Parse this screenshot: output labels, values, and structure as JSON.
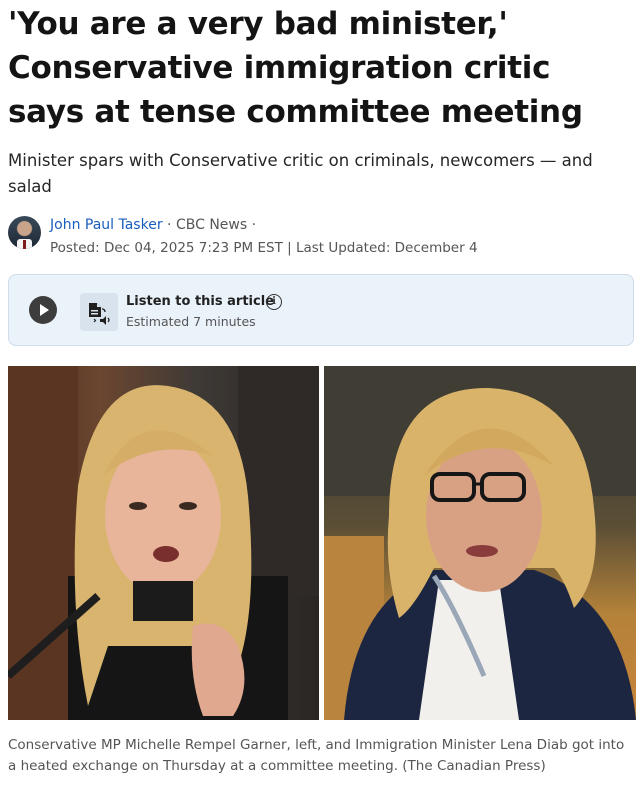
{
  "article": {
    "headline": "'You are a very bad minister,' Conservative immigration critic says at tense committee meeting",
    "dek": "Minister spars with Conservative critic on criminals, newcomers — and salad"
  },
  "byline": {
    "author": "John Paul Tasker",
    "separator1": " · ",
    "outlet": "CBC News",
    "separator2": " ·",
    "posted": "Posted: Dec 04, 2025 7:23 PM EST | Last Updated: December 4"
  },
  "audio": {
    "title": "Listen to this article",
    "duration": "Estimated 7 minutes",
    "info_glyph": "i",
    "icons": [
      "play-icon",
      "document-audio-icon",
      "info-icon"
    ]
  },
  "photo": {
    "caption": "Conservative MP Michelle Rempel Garner, left, and Immigration Minister Lena Diab got into a heated exchange on Thursday at a committee meeting. (The Canadian Press)"
  },
  "colors": {
    "link": "#1a5ebd",
    "audio_card_bg": "#eaf2fa",
    "play_button": "#3d3d3d"
  }
}
